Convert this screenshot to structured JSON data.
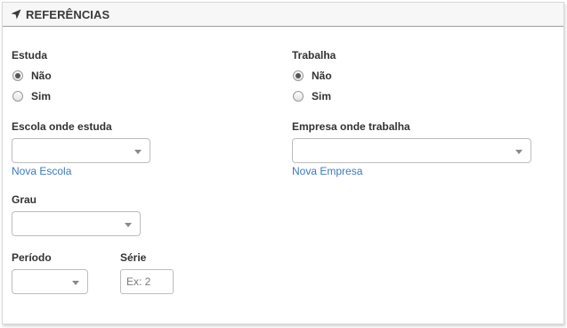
{
  "panel": {
    "title": "REFERÊNCIAS",
    "icon": "location-arrow-icon"
  },
  "estuda": {
    "label": "Estuda",
    "options": [
      {
        "label": "Não",
        "checked": true
      },
      {
        "label": "Sim",
        "checked": false
      }
    ]
  },
  "trabalha": {
    "label": "Trabalha",
    "options": [
      {
        "label": "Não",
        "checked": true
      },
      {
        "label": "Sim",
        "checked": false
      }
    ]
  },
  "escola": {
    "label": "Escola onde estuda",
    "value": "",
    "link": "Nova Escola"
  },
  "empresa": {
    "label": "Empresa onde trabalha",
    "value": "",
    "link": "Nova Empresa"
  },
  "grau": {
    "label": "Grau",
    "value": ""
  },
  "periodo": {
    "label": "Período",
    "value": ""
  },
  "serie": {
    "label": "Série",
    "value": "",
    "placeholder": "Ex: 2"
  },
  "colors": {
    "link": "#3a7bbf",
    "header_bg": "#f7f7f7",
    "border": "#bdbdbd"
  }
}
